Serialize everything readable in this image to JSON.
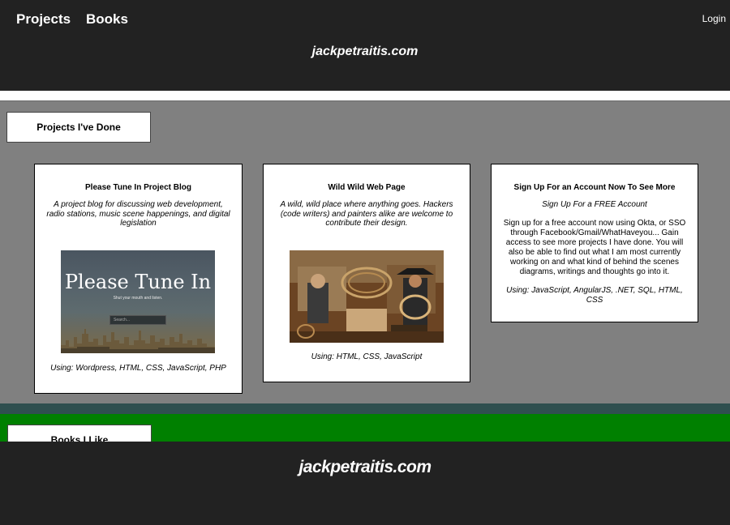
{
  "header": {
    "nav": [
      {
        "label": "Projects"
      },
      {
        "label": "Books"
      }
    ],
    "login_label": "Login",
    "site_title": "jackpetraitis.com"
  },
  "projects_section": {
    "title": "Projects I've Done",
    "cards": [
      {
        "title": "Please Tune In Project Blog",
        "description": "A project blog for discussing web development, radio stations, music scene happenings, and digital legislation",
        "image": {
          "headline": "Please Tune In",
          "subtitle": "Shut your mouth and listen.",
          "search_placeholder": "Search..."
        },
        "using": "Using: Wordpress, HTML, CSS, JavaScript, PHP"
      },
      {
        "title": "Wild Wild Web Page",
        "description": "A wild, wild place where anything goes. Hackers (code writers) and painters alike are welcome to contribute their design.",
        "using": "Using: HTML, CSS, JavaScript"
      },
      {
        "title": "Sign Up For an Account Now To See More",
        "subtitle": "Sign Up For a FREE Account",
        "body": "Sign up for a free account now using Okta, or SSO through Facebook/Gmail/WhatHaveyou... Gain access to see more projects I have done. You will also be able to find out what I am most currently working on and what kind of behind the scenes diagrams, writings and thoughts go into it.",
        "using": "Using: JavaScript, AngularJS, .NET, SQL, HTML, CSS"
      }
    ]
  },
  "books_section": {
    "title": "Books I Like"
  },
  "footer": {
    "title": "jackpetraitis.com"
  },
  "colors": {
    "header_bg": "#222222",
    "projects_bg": "#808080",
    "books_bg": "#008000",
    "divider": "#2f4f4f"
  }
}
